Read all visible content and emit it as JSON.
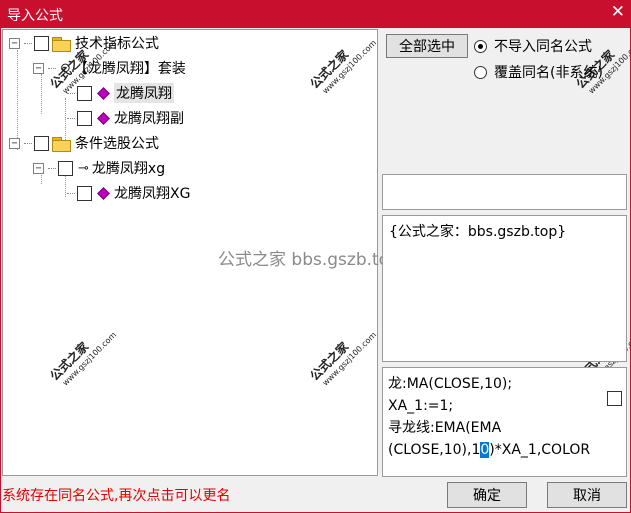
{
  "window": {
    "title": "导入公式",
    "close_glyph": "✕"
  },
  "tree": {
    "group1": {
      "label": "技术指标公式",
      "expand": "−"
    },
    "suite": {
      "label": "【龙腾凤翔】套装",
      "expand": "−"
    },
    "item1": {
      "label": "龙腾凤翔"
    },
    "item2": {
      "label": "龙腾凤翔副"
    },
    "group2": {
      "label": "条件选股公式",
      "expand": "−"
    },
    "item3": {
      "label": "龙腾凤翔xg",
      "expand": "−"
    },
    "item4": {
      "label": "龙腾凤翔XG"
    }
  },
  "watermark": {
    "brand": "公式之家",
    "url": "www.gszj100.com",
    "center": "公式之家 bbs.gszb.top"
  },
  "buttons": {
    "select_all": "全部选中",
    "ok": "确定",
    "cancel": "取消"
  },
  "options": {
    "no_import": "不导入同名公式",
    "overwrite": "覆盖同名(非系统)",
    "selected": "no_import"
  },
  "description": "{公式之家：bbs.gszb.top}",
  "code": {
    "line1": "龙:MA(CLOSE,10);",
    "line2": "XA_1:=1;",
    "line3": "寻龙线:EMA(EMA",
    "line4_a": "(CLOSE,10),1",
    "line4_sel": "0",
    "line4_b": ")*XA_1,COLOR"
  },
  "status": "系统存在同名公式,再次点击可以更名"
}
